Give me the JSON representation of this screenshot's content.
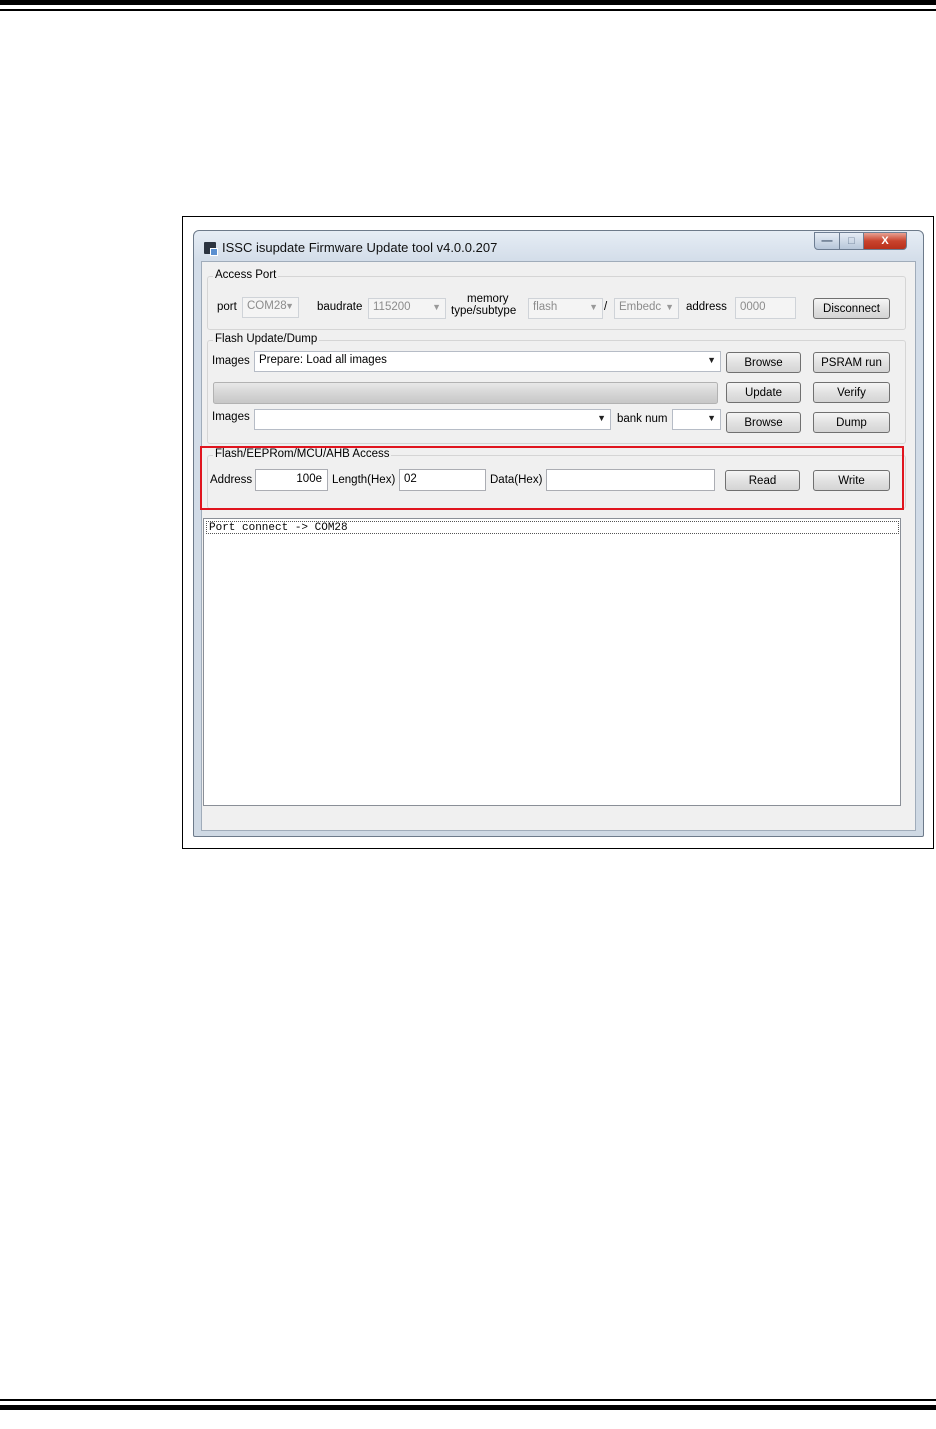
{
  "window": {
    "title": "ISSC isupdate Firmware Update tool  v4.0.0.207"
  },
  "caption_buttons": {
    "minimize": "—",
    "maximize": "□",
    "close": "X"
  },
  "access_port": {
    "label": "Access Port",
    "port_label": "port",
    "port_value": "COM28",
    "baudrate_label": "baudrate",
    "baudrate_value": "115200",
    "memory_label_line1": "memory",
    "memory_label_line2": "type/subtype",
    "memory_type_value": "flash",
    "slash": "/",
    "memory_subtype_value": "Embedc",
    "address_label": "address",
    "address_value": "0000",
    "disconnect_button": "Disconnect"
  },
  "flash_update": {
    "label": "Flash Update/Dump",
    "images_label": "Images",
    "images_value": "Prepare: Load all images",
    "browse_button": "Browse",
    "psram_button": "PSRAM run",
    "progress": 0,
    "update_button": "Update",
    "verify_button": "Verify",
    "images2_label": "Images",
    "images2_value": "",
    "bank_label": "bank num",
    "bank_value": "",
    "browse2_button": "Browse",
    "dump_button": "Dump"
  },
  "access": {
    "label": "Flash/EEPRom/MCU/AHB Access",
    "address_label": "Address",
    "address_value": "100e",
    "length_label": "Length(Hex)",
    "length_value": "02",
    "data_label": "Data(Hex)",
    "data_value": "",
    "read_button": "Read",
    "write_button": "Write"
  },
  "log": {
    "lines": [
      "Port connect -> COM28"
    ]
  },
  "colors": {
    "highlight": "#e0141e",
    "close_button": "#c9432d"
  }
}
